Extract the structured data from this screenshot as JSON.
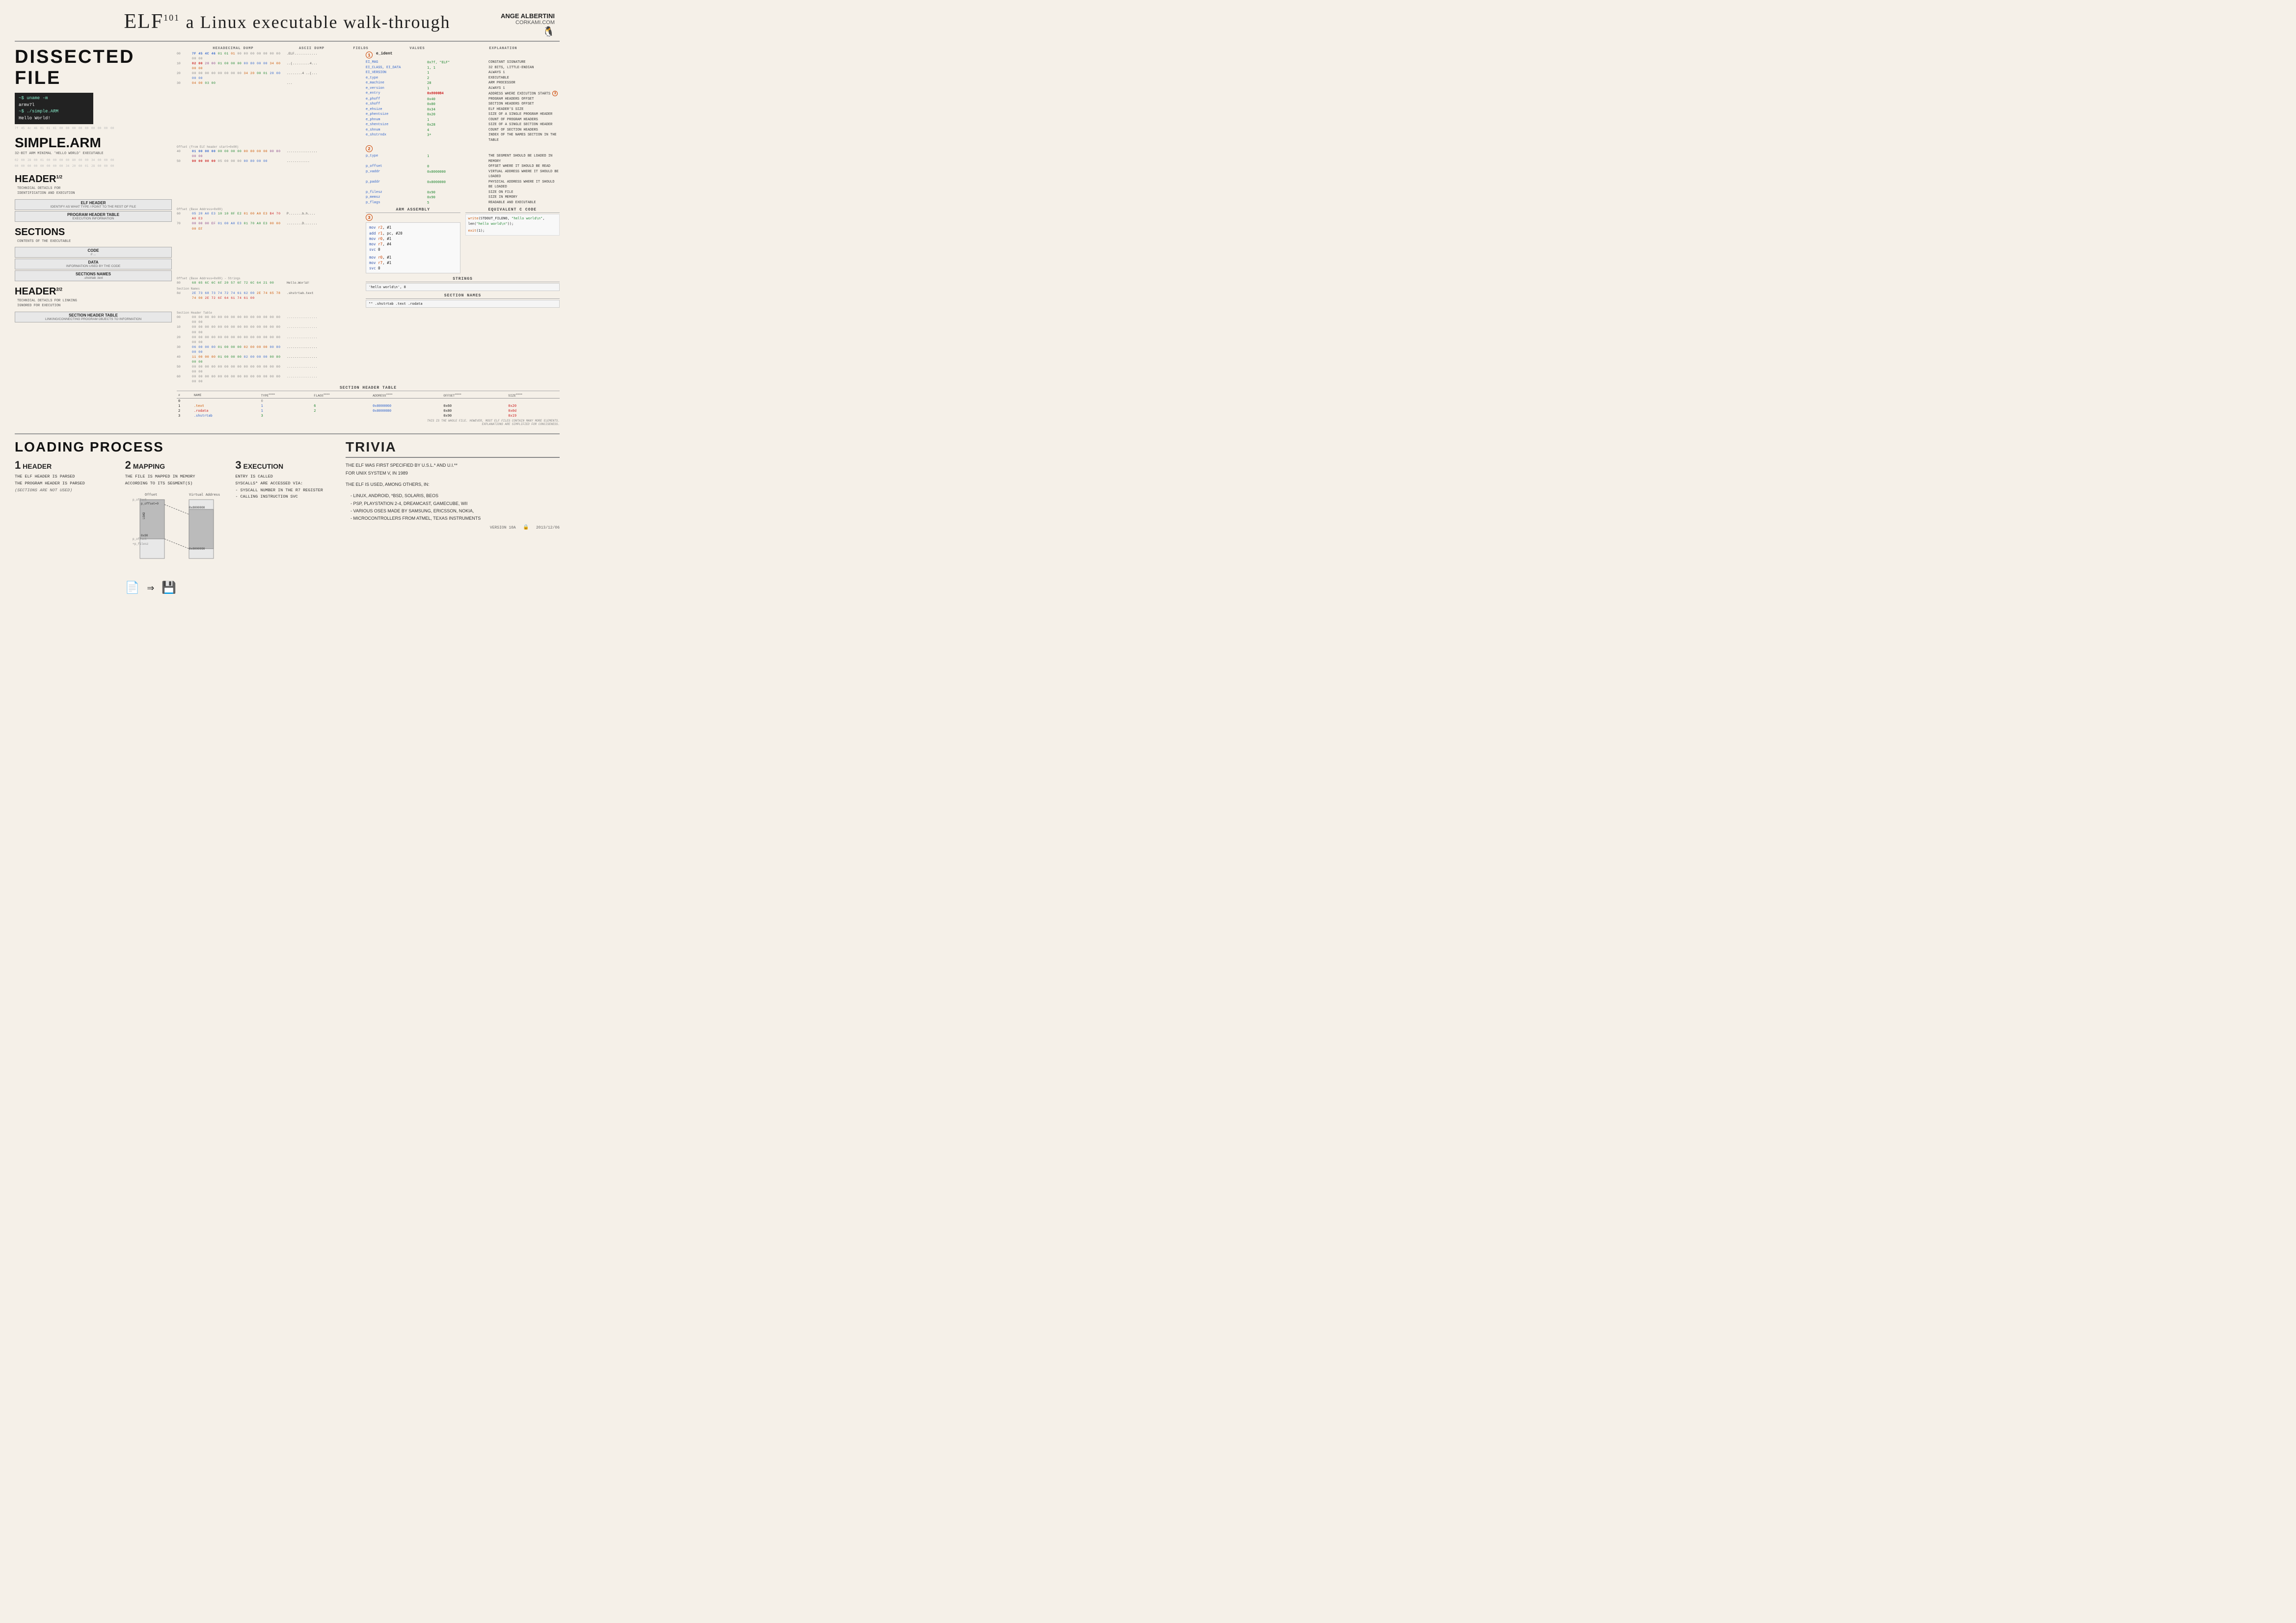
{
  "title": {
    "main": "ELF",
    "sup": "101",
    "subtitle": "a Linux executable walk-through",
    "author_name": "ANGE ALBERTINI",
    "author_url": "CORKAMI.COM"
  },
  "left_panel": {
    "section_title": "DISSECTED FILE",
    "terminal": {
      "line1": "~$ uname -m",
      "line2": "armv7l",
      "line3": "~$ ./simple.ARM",
      "line4": "Hello World!"
    },
    "filename": "SIMPLE.ARM",
    "filename_sub": "32-BIT ARM MINIMAL 'HELLO WORLD' EXECUTABLE",
    "sections": [
      {
        "name": "HEADER",
        "sup": "1/2",
        "desc1": "TECHNICAL DETAILS FOR",
        "desc2": "IDENTIFICATION AND EXECUTION"
      },
      {
        "name": "SECTIONS",
        "sup": "",
        "desc1": "CONTENTS OF THE EXECUTABLE"
      },
      {
        "name": "HEADER",
        "sup": "2/2",
        "desc1": "TECHNICAL DETAILS FOR LINKING",
        "desc2": "IGNORED FOR EXECUTION"
      }
    ],
    "struct_blocks": [
      {
        "title": "ELF HEADER",
        "sub": "IDENTIFY AS WHAT TYPE / POINT TO THE REST OF FILE"
      },
      {
        "title": "PROGRAM HEADER TABLE",
        "sub": "EXECUTION INFORMATION"
      },
      {
        "title": "CODE",
        "sub": "// ..."
      },
      {
        "title": "DATA",
        "sub": "INFORMATION USED BY THE CODE"
      },
      {
        "title": "SECTIONS NAMES",
        "sub": ".shstrtab .text"
      },
      {
        "title": "SECTION HEADER TABLE",
        "sub": "LINKING/CONNECTING PROGRAM OBJECTS TO INFORMATION"
      }
    ]
  },
  "col_headers": {
    "hex": "HEXADECIMAL DUMP",
    "ascii": "ASCII DUMP",
    "fields": "FIELDS",
    "values": "VALUES",
    "explain": "EXPLANATION"
  },
  "hex_rows": [
    {
      "off": "",
      "hex": "7F 45 4C 46 01 01 01 00 00 00 00 00 00 00 00 00",
      "asc": ".ELF............"
    },
    {
      "off": "",
      "hex": "02 00 28 00 01 00 00 00 00 80 00 00 34 00 00 00",
      "asc": "..(.........4..."
    },
    {
      "off": "",
      "hex": "00 00 00 00 00 00 00 00 34 20 00 01 28 00 00 00",
      "asc": "........4 ..(..."
    },
    {
      "off": "",
      "hex": "04 00 03 00",
      "asc": "..."
    }
  ],
  "elf_header_fields": [
    {
      "num": "1",
      "field": "e_ident",
      "value": "",
      "explain": ""
    },
    {
      "field": "EI_MAG",
      "value": "0x7F, \"ELF\"",
      "explain": "CONSTANT SIGNATURE"
    },
    {
      "field": "EI_CLASS, EI_DATA",
      "value": "1====",
      "explain": "32 BITS, LITTLE-ENDIAN"
    },
    {
      "field": "EI_VERSION",
      "value": "1=====",
      "explain": "ALWAYS 1"
    },
    {
      "field": "e_type",
      "value": "2====",
      "explain": "EXECUTABLE"
    },
    {
      "field": "e_machine",
      "value": "28====",
      "explain": "ARM PROCESSOR"
    },
    {
      "field": "e_version",
      "value": "1====",
      "explain": "ALWAYS 1"
    },
    {
      "field": "e_entry",
      "value": "0x8000B4",
      "explain": "ADDRESS WHERE EXECUTION STARTS"
    },
    {
      "field": "e_phoff",
      "value": "0x40",
      "explain": "PROGRAM HEADERS OFFSET"
    },
    {
      "field": "e_shoff",
      "value": "0x80",
      "explain": "SECTION HEADERS OFFSET"
    },
    {
      "field": "e_ehsize",
      "value": "0x34",
      "explain": "ELF HEADER'S SIZE"
    },
    {
      "field": "e_phentsize",
      "value": "0x20",
      "explain": "SIZE OF A SINGLE PROGRAM HEADER"
    },
    {
      "field": "e_phnum",
      "value": "1",
      "explain": "COUNT OF PROGRAM HEADERS"
    },
    {
      "field": "e_shentsize",
      "value": "0x28",
      "explain": "SIZE OF A SINGLE SECTION HEADER"
    },
    {
      "field": "e_shnum",
      "value": "4",
      "explain": "COUNT OF SECTION HEADERS"
    },
    {
      "field": "e_shstrndx",
      "value": "3*",
      "explain": "INDEX OF THE NAMES SECTION IN THE TABLE"
    }
  ],
  "program_header_rows": [
    {
      "off": "",
      "hex": "01 00 00 00 00 00 00 00 00 80 00 00 00 80 00 00",
      "asc": "................"
    },
    {
      "off": "",
      "hex": "90 00 00 00 05 00 00 00 00 80 00 00",
      "asc": "............"
    }
  ],
  "program_header_fields": [
    {
      "num": "2",
      "field": "p_type",
      "value": "1====",
      "explain": "THE SEGMENT SHOULD BE LOADED IN MEMORY"
    },
    {
      "field": "p_offset",
      "value": "0",
      "explain": "OFFSET WHERE IT SHOULD BE READ"
    },
    {
      "field": "p_vaddr",
      "value": "0x8000000",
      "explain": "VIRTUAL ADDRESS WHERE IT SHOULD BE LOADED"
    },
    {
      "field": "p_paddr",
      "value": "0x8000000",
      "explain": "PHYSICAL ADDRESS WHERE IT SHOULD BE LOADED"
    },
    {
      "field": "p_filesz",
      "value": "0x90",
      "explain": "SIZE ON FILE"
    },
    {
      "field": "p_memsz",
      "value": "0x90",
      "explain": "SIZE IN MEMORY"
    },
    {
      "field": "p_flags",
      "value": "5====",
      "explain": "READABLE AND EXECUTABLE"
    }
  ],
  "arm_assembly": {
    "title": "ARM ASSEMBLY",
    "num": "3",
    "lines": [
      "mov r2, #1",
      "add r1, pc, #20",
      "mov r0, #1",
      "mov r7, #4",
      "svc 0          @ write(STDOUT_FILENO, 'hello world\\n', len('hello world\\n'));",
      "",
      "mov r0, #1",
      "mov r7, #1",
      "svc 0          @ exit(1);"
    ]
  },
  "equivalent_c": {
    "title": "EQUIVALENT C CODE",
    "lines": [
      "write(STDOUT_FILENO, \"hello world\\n\", len(\"hello world\\n\"));",
      "",
      "exit(1);"
    ]
  },
  "strings": {
    "title": "STRINGS",
    "items": [
      "'hello world\\n', 8"
    ]
  },
  "section_names": {
    "title": "SECTION NAMES",
    "value": "\"\" .shstrtab .text  .rodata"
  },
  "section_header_table": {
    "title": "SECTION HEADER TABLE",
    "headers": [
      "#",
      "NAME",
      "TYPE====",
      "FLAGS====",
      "ADDRESS====",
      "OFFSET====",
      "SIZE===="
    ],
    "rows": [
      {
        "num": "0",
        "name": "",
        "type": "0",
        "flags": "",
        "address": "",
        "offset": "",
        "size": ""
      },
      {
        "num": "1",
        "name": ".text",
        "type": "1====",
        "flags": "6",
        "address": "0x8000060",
        "offset": "0x60",
        "size": "0x20"
      },
      {
        "num": "2",
        "name": ".rodata",
        "type": "1====",
        "flags": "2",
        "address": "0x8000080",
        "offset": "0x80",
        "size": "0x0d"
      },
      {
        "num": "3",
        "name": ".shstrtab",
        "type": "3====",
        "flags": "",
        "address": "",
        "offset": "0x90",
        "size": "0x19"
      }
    ]
  },
  "loading_section": {
    "title": "LOADING PROCESS",
    "steps": [
      {
        "num": "1",
        "title": "HEADER",
        "lines": [
          "THE ELF HEADER IS PARSED",
          "THE PROGRAM HEADER IS PARSED",
          "(SECTIONS ARE NOT USED)"
        ]
      },
      {
        "num": "2",
        "title": "MAPPING",
        "lines": [
          "THE FILE IS MAPPED IN MEMORY",
          "ACCORDING TO ITS SEGMENT(S)"
        ]
      },
      {
        "num": "3",
        "title": "EXECUTION",
        "lines": [
          "ENTRY IS CALLED",
          "SYSCALLS* ARE ACCESSED VIA:",
          "- SYSCALL NUMBER IN THE R7 REGISTER",
          "- CALLING INSTRUCTION SVC"
        ]
      }
    ],
    "diagram": {
      "offset_label": "Offset",
      "virtual_label": "Virtual Address",
      "p_offset": "p_offset=0",
      "addr_start": "0x8000000",
      "segment_label": "LOAD Segment",
      "p_offset_val": "0x90",
      "addr_end": "0x8000090"
    }
  },
  "trivia": {
    "title": "TRIVIA",
    "text1": "THE ELF WAS FIRST SPECIFIED BY U.S.L.* AND U.I.**",
    "text1_note": "FOR UNIX SYSTEM V, IN 1989",
    "text2_intro": "THE ELF IS USED, AMONG OTHERS, IN:",
    "bullets": [
      "- LINUX, ANDROID, *BSD, SOLARIS, BEOS",
      "- PSP, PLAYSTATION 2-4, DREAMCAST, GAMECUBE, WII",
      "- VARIOUS OSES MADE BY SAMSUNG, ERICSSON, NOKIA,",
      "- MICROCONTROLLERS FROM ATMEL, TEXAS INSTRUMENTS"
    ]
  },
  "footer": {
    "version": "VERSION 10A",
    "date": "2013/12/06"
  }
}
